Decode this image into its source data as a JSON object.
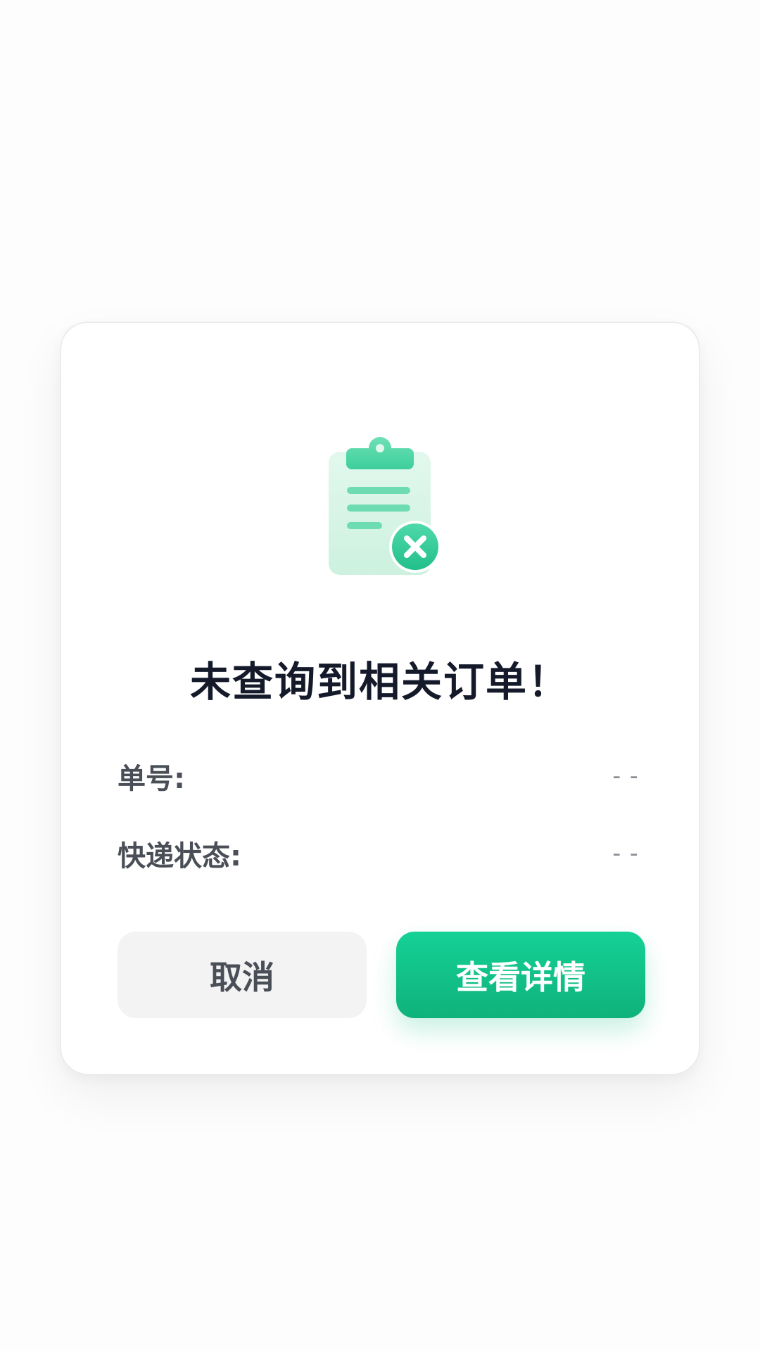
{
  "dialog": {
    "icon": "clipboard-error-icon",
    "title": "未查询到相关订单！",
    "fields": [
      {
        "label": "单号:",
        "value": "--"
      },
      {
        "label": "快递状态:",
        "value": "--"
      }
    ],
    "cancel_label": "取消",
    "detail_label": "查看详情"
  },
  "colors": {
    "accent": "#12c48a",
    "accent_light": "#d4f5e6",
    "title": "#141a2a",
    "label": "#4a4f57",
    "muted": "#8a8f96",
    "cancel_bg": "#f3f3f3"
  }
}
